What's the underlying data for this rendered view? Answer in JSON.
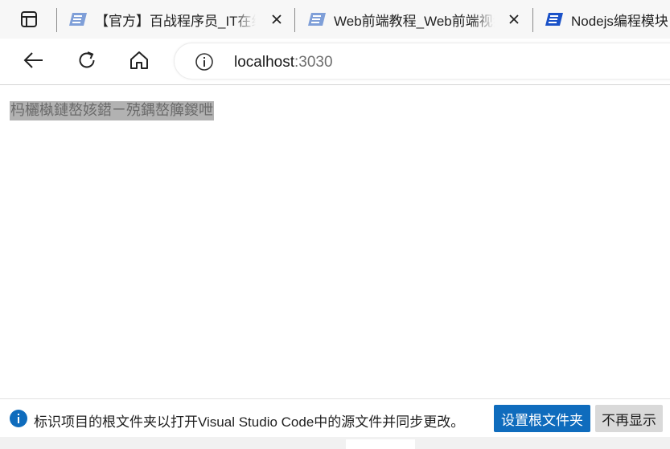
{
  "tabs": [
    {
      "title": "【官方】百战程序员_IT在线教育",
      "active": false
    },
    {
      "title": "Web前端教程_Web前端视频",
      "active": false
    },
    {
      "title": "Nodejs编程模块",
      "active": true
    }
  ],
  "address_bar": {
    "host": "localhost",
    "port": ":3030"
  },
  "page": {
    "garbled_text": "杩欐槸鏈嶅姟鍣ㄧ殑鍝嶅簲鍐呭"
  },
  "infobar": {
    "message": "标识项目的根文件夹以打开Visual Studio Code中的源文件并同步更改。",
    "primary_button": "设置根文件夹",
    "secondary_button": "不再显示"
  },
  "colors": {
    "accent": "#0f6cbd",
    "favicon": "#1b52c8",
    "tab_strip": "#f7f7f7"
  },
  "icons": [
    "tab-actions-icon",
    "site-favicon",
    "close-icon",
    "back-arrow-icon",
    "refresh-icon",
    "home-icon",
    "site-info-icon",
    "info-icon"
  ]
}
